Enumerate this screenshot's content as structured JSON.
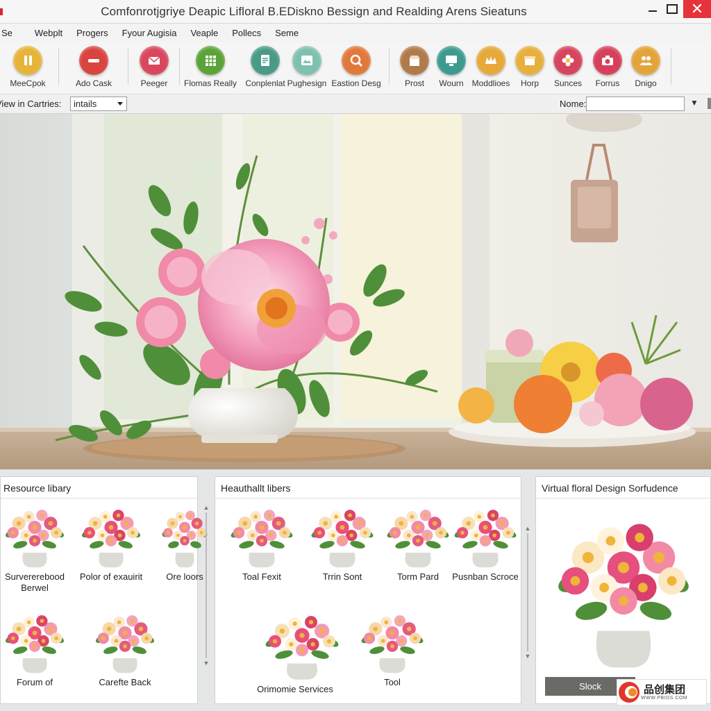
{
  "window": {
    "title": "Comfonrotjgriye Deapic Lifloral  B.EDiskno Bessign and Realding Arens Sieatuns",
    "close_glyph": "✕"
  },
  "menu": [
    "Se",
    "Webplt",
    "Progers",
    "Fyour Augisia",
    "Veaple",
    "Pollecs",
    "Seme"
  ],
  "toolbar": [
    {
      "label": "MeeCpok",
      "icon": "pause-icon",
      "color": "#e7b43a"
    },
    {
      "label": "Ado Cask",
      "icon": "record-icon",
      "color": "#d9443f"
    },
    {
      "label": "Peeger",
      "icon": "mail-icon",
      "color": "#d9475e"
    },
    {
      "label": "Flomas Really",
      "icon": "grid-icon",
      "color": "#5aa336"
    },
    {
      "label": "Conplenlat",
      "icon": "document-icon",
      "color": "#4b9a88"
    },
    {
      "label": "Pughesign",
      "icon": "image-icon",
      "color": "#7fc1b0"
    },
    {
      "label": "Eastion Desg",
      "icon": "search-icon",
      "color": "#e2793c"
    },
    {
      "label": "Prost",
      "icon": "shop-icon",
      "color": "#b07a4a"
    },
    {
      "label": "Wourn",
      "icon": "monitor-icon",
      "color": "#3e9a8e"
    },
    {
      "label": "Moddlioes",
      "icon": "crown-icon",
      "color": "#e6a93a"
    },
    {
      "label": "Horp",
      "icon": "box-icon",
      "color": "#e7b03e"
    },
    {
      "label": "Sunces",
      "icon": "flower-icon",
      "color": "#d7445e"
    },
    {
      "label": "Forrus",
      "icon": "camera-icon",
      "color": "#d6405a"
    },
    {
      "label": "Dnigo",
      "icon": "users-icon",
      "color": "#e4a43c"
    }
  ],
  "filter": {
    "view_label": "View in Cartries:",
    "view_value": "intails",
    "name_label": "Nome:",
    "name_value": ""
  },
  "panels": {
    "resource": {
      "title": "Resource libary",
      "items": [
        "Survererebood Berwel",
        "Polor of exauirit",
        "Ore loors",
        "Forum of",
        "Carefte Back"
      ]
    },
    "heauthallt": {
      "title": "Heauthallt libers",
      "items": [
        "Toal Fexit",
        "Trrin Sont",
        "Torm Pard",
        "Pusnban Scroce",
        "Orimomie Services",
        "Tool"
      ]
    },
    "virtual": {
      "title": "Virtual floral Design Sorfudence",
      "button": "Slock"
    }
  },
  "watermark": {
    "text": "品创集团",
    "sub": "WWW.PBIDS.COM"
  },
  "colors": {
    "accent": "#e5323b",
    "petal": "#f2a0bb",
    "leaf": "#4f8f3a"
  }
}
